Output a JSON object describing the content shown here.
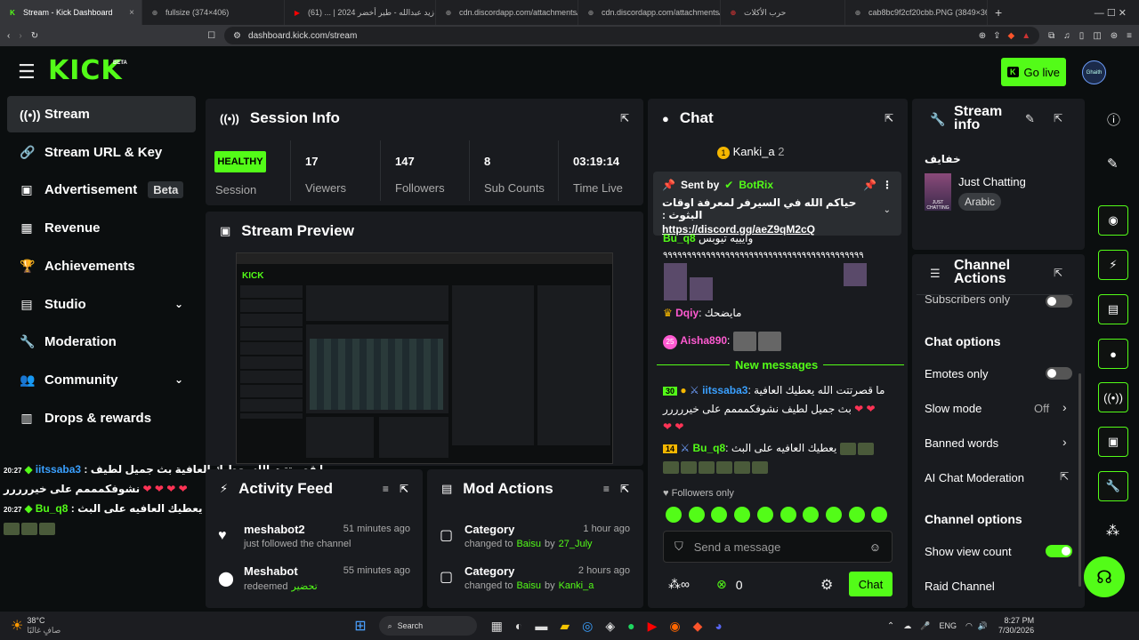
{
  "browser": {
    "tabs": [
      {
        "label": "Stream - Kick Dashboard",
        "fav": "K",
        "favcolor": "#53fc18"
      },
      {
        "label": "fullsize (374×406)",
        "fav": "⊕",
        "favcolor": "#888"
      },
      {
        "label": "زيد عبدالله - طير أخضر 2024 | ... (61)",
        "fav": "▶",
        "favcolor": "#ff0000"
      },
      {
        "label": "cdn.discordapp.com/attachments/14",
        "fav": "⊕",
        "favcolor": "#888"
      },
      {
        "label": "cdn.discordapp.com/attachments/15",
        "fav": "⊕",
        "favcolor": "#888"
      },
      {
        "label": "حرب الأكلات",
        "fav": "⊕",
        "favcolor": "#c33"
      },
      {
        "label": "cab8bc9f2cf20cbb.PNG (3849×3600)",
        "fav": "⊕",
        "favcolor": "#888"
      }
    ],
    "url": "dashboard.kick.com/stream"
  },
  "header": {
    "logo": "KICK",
    "logo_sup": "BETA",
    "go_live": "Go live",
    "avatar": "Ghaith"
  },
  "sidebar": [
    {
      "label": "Stream",
      "icon": "((•))",
      "active": true
    },
    {
      "label": "Stream URL & Key",
      "icon": "🔗"
    },
    {
      "label": "Advertisement",
      "icon": "▣",
      "badge": "Beta"
    },
    {
      "label": "Revenue",
      "icon": "▦"
    },
    {
      "label": "Achievements",
      "icon": "🏆"
    },
    {
      "label": "Studio",
      "icon": "▤",
      "chevron": true
    },
    {
      "label": "Moderation",
      "icon": "🔧"
    },
    {
      "label": "Community",
      "icon": "👥",
      "chevron": true
    },
    {
      "label": "Drops & rewards",
      "icon": "▥"
    }
  ],
  "session": {
    "title": "Session Info",
    "health": "HEALTHY",
    "health_label": "Session",
    "stats": [
      {
        "value": "17",
        "label": "Viewers"
      },
      {
        "value": "147",
        "label": "Followers"
      },
      {
        "value": "8",
        "label": "Sub Counts"
      },
      {
        "value": "03:19:14",
        "label": "Time Live"
      }
    ]
  },
  "preview": {
    "title": "Stream Preview"
  },
  "overlay_chat": [
    {
      "time": "20:27",
      "user": "iitssaba3",
      "msg": "ما قصرتتت الله يعطيك العافية بث جميل لطيف نشوفكمممم على خيررررر"
    },
    {
      "time": "20:27",
      "user": "Bu_q8",
      "msg": "يعطيك العافيه على البث :"
    }
  ],
  "activity": {
    "title": "Activity Feed",
    "items": [
      {
        "user": "meshabot2",
        "time": "51 minutes ago",
        "desc": "just followed the channel",
        "icon": "♥"
      },
      {
        "user": "Meshabot",
        "time": "55 minutes ago",
        "desc": "redeemed",
        "extra": "تحضير",
        "icon": "⬤"
      }
    ]
  },
  "mod_actions": {
    "title": "Mod Actions",
    "items": [
      {
        "title": "Category",
        "time": "1 hour ago",
        "prefix": "changed to",
        "cat": "Baisu",
        "by": "by",
        "user": "27_July"
      },
      {
        "title": "Category",
        "time": "2 hours ago",
        "prefix": "changed to",
        "cat": "Baisu",
        "by": "by",
        "user": "Kanki_a"
      }
    ]
  },
  "chat": {
    "title": "Chat",
    "top_user": "Kanki_a",
    "top_count": "2",
    "pinned_by": "Sent by",
    "pinned_user": "BotRix",
    "pinned_msg": "حياكم الله في السيرفر لمعرفة اوقات البثوث :",
    "pinned_link": "https://discord.gg/aeZ9qM2cQ",
    "line1_user": "Bu_q8",
    "line1_msg": "وايييه تيوبس",
    "line2_msg": "٩٩٩٩٩٩٩٩٩٩٩٩٩٩٩٩٩٩٩٩٩٩٩٩٩٩٩٩٩٩٩٩٩٩٩٩٩٩٩٩٩٩",
    "dqiy_user": "Dqiy",
    "dqiy_msg": "مايضحك",
    "aisha_user": "Aisha890",
    "aisha_badge": "25",
    "new_messages": "New messages",
    "m1_badge": "30",
    "m1_user": "iitssaba3",
    "m1_msg": "ما قصرتتت الله يعطيك العافية بث جميل لطيف نشوفكمممم على خيررررر",
    "m2_badge": "14",
    "m2_user": "Bu_q8",
    "m2_msg": "يعطيك العافيه على البث",
    "followers_only": "Followers only",
    "placeholder": "Send a message",
    "count": "0",
    "chat_btn": "Chat"
  },
  "stream_info": {
    "title": "Stream info",
    "stream_title": "خفايف",
    "category": "Just Chatting",
    "tag": "Arabic",
    "thumb": "JUST CHATTING"
  },
  "channel_actions": {
    "title": "Channel Actions",
    "subs_only": "Subscribers only",
    "chat_options": "Chat options",
    "emotes_only": "Emotes only",
    "slow_mode": "Slow mode",
    "slow_value": "Off",
    "banned_words": "Banned words",
    "ai_mod": "AI Chat Moderation",
    "channel_options": "Channel options",
    "show_view": "Show view count",
    "raid": "Raid Channel"
  },
  "taskbar": {
    "temp": "38°C",
    "weather": "صافٍ غالبًا",
    "search": "Search",
    "lang": "ENG",
    "time": "8:27 PM",
    "date": "7/30/2026"
  }
}
